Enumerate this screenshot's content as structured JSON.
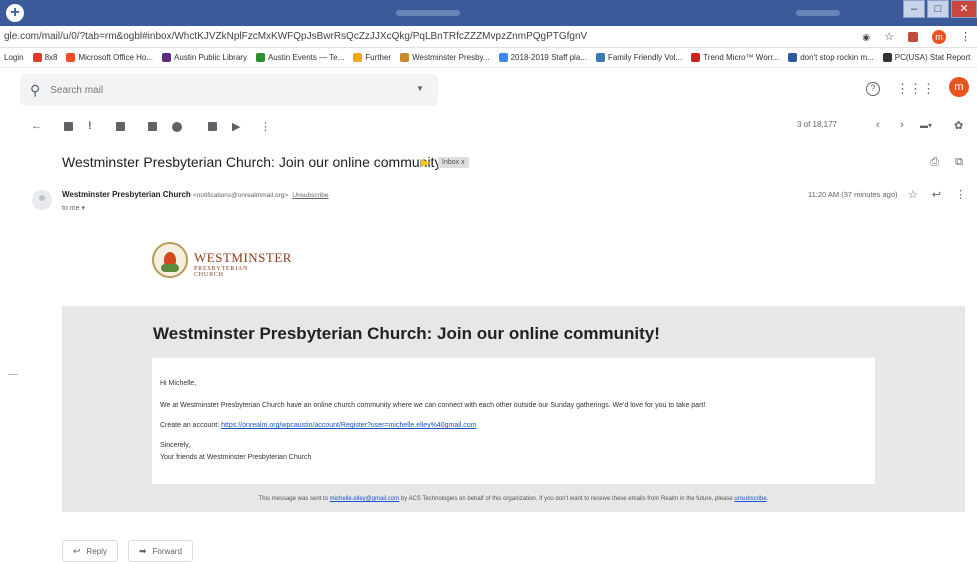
{
  "browser": {
    "url": "gle.com/mail/u/0/?tab=rm&ogbl#inbox/WhctKJVZkNplFzcMxKWFQpJsBwrRsQcZzJJXcQkg/PqLBnTRfcZZZMvpzZnmPQgPTGfgnV",
    "account_initial": "m",
    "newtab_icon": "plus-icon"
  },
  "bookmarks": [
    {
      "label": "Login",
      "color": "#ffffff"
    },
    {
      "label": "8x8",
      "color": "#e03a2a"
    },
    {
      "label": "Microsoft Office Ho...",
      "color": "#f25022"
    },
    {
      "label": "Austin Public Library",
      "color": "#5b2d82"
    },
    {
      "label": "Austin Events — Te...",
      "color": "#2f8f2f"
    },
    {
      "label": "Further",
      "color": "#f0a818"
    },
    {
      "label": "Westminster Presby...",
      "color": "#c88a2a"
    },
    {
      "label": "2018-2019 Staff pla...",
      "color": "#4285f4"
    },
    {
      "label": "Family Friendly Vol...",
      "color": "#3a7ab0"
    },
    {
      "label": "Trend Micro™ Worr...",
      "color": "#d02020"
    },
    {
      "label": "don't stop rockin m...",
      "color": "#2a5a9a"
    },
    {
      "label": "PC(USA) Stat Report",
      "color": "#333333"
    }
  ],
  "gmail": {
    "search_placeholder": "Search mail",
    "avatar_initial": "m",
    "pager": "3 of 18,177"
  },
  "email": {
    "subject": "Westminster Presbyterian Church: Join our online community!",
    "label_chip": "Inbox x",
    "sender_name": "Westminster Presbyterian Church",
    "sender_email": "<notifications@onrealmmail.org>",
    "unsubscribe": "Unsubscribe",
    "to": "to me ▾",
    "time": "11:20 AM (37 minutes ago)",
    "logo_title": "WESTMINSTER",
    "logo_sub": "PRESBYTERIAN CHURCH",
    "panel_title": "Westminster Presbyterian Church: Join our online community!",
    "greeting": "Hi Michelle,",
    "body1": "We at Westminster Presbyterian Church have an online church community where we can connect with each other outside our Sunday gatherings. We'd love for you to take part!",
    "create_prefix": "Create an account: ",
    "create_link": "https://onrealm.org/wpcaustin/account/Register?user=michelle.elley%40gmail.com",
    "sincerely": "Sincerely,",
    "signoff": "Your friends at Westminster Presbyterian Church",
    "footer_prefix": "This message was sent to ",
    "footer_email": "michelle.elley@gmail.com",
    "footer_mid": " by ACS Technologies on behalf of this organization. If you don't want to receive these emails from Realm in the future, please ",
    "footer_link": "unsubscribe",
    "footer_end": "."
  },
  "actions": {
    "reply": "Reply",
    "forward": "Forward"
  }
}
